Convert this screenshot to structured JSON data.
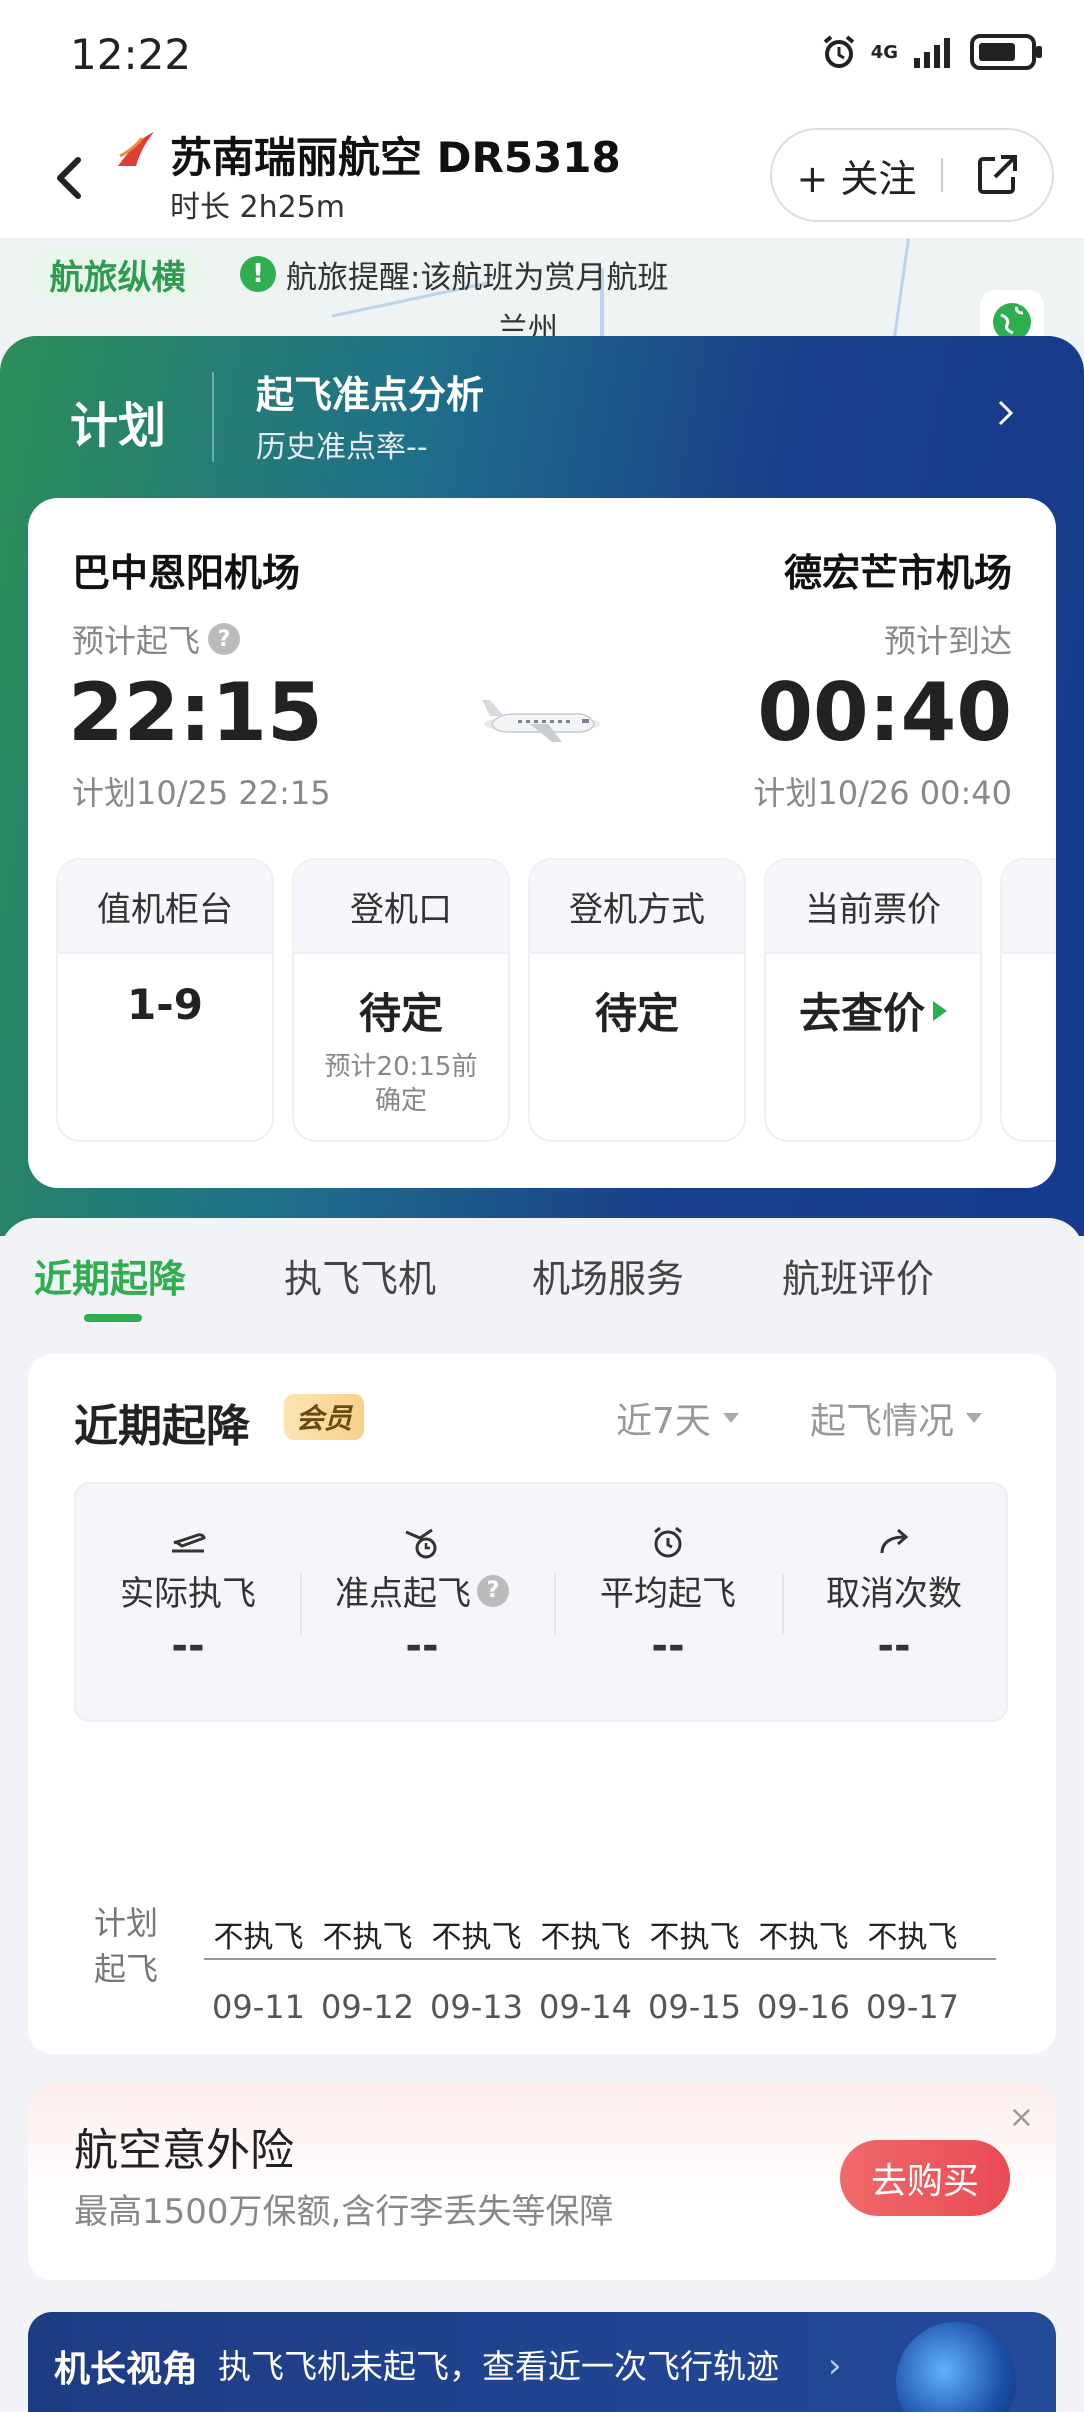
{
  "status_bar": {
    "time": "12:22",
    "network": "4G"
  },
  "header": {
    "title": "苏南瑞丽航空 DR5318",
    "duration": "时长 2h25m",
    "follow_label": "+ 关注"
  },
  "map_strip": {
    "brand": "航旅纵横",
    "alert_icon": "!",
    "alert_text": "航旅提醒:该航班为赏月航班",
    "city": "兰州"
  },
  "hero": {
    "plan_label": "计划",
    "ontime_title": "起飞准点分析",
    "ontime_sub": "历史准点率--"
  },
  "flight": {
    "dep_airport": "巴中恩阳机场",
    "arr_airport": "德宏芒市机场",
    "dep_label": "预计起飞",
    "arr_label": "预计到达",
    "dep_time": "22:15",
    "arr_time": "00:40",
    "dep_plan": "计划10/25 22:15",
    "arr_plan": "计划10/26 00:40",
    "help_icon": "?"
  },
  "info_cards": [
    {
      "head": "值机柜台",
      "value": "1-9",
      "note": ""
    },
    {
      "head": "登机口",
      "value": "待定",
      "note": "预计20:15前确定"
    },
    {
      "head": "登机方式",
      "value": "待定",
      "note": ""
    },
    {
      "head": "当前票价",
      "value": "去查价",
      "note": ""
    }
  ],
  "tabs": [
    "近期起降",
    "执飞飞机",
    "机场服务",
    "航班评价"
  ],
  "recent": {
    "title": "近期起降",
    "member_badge": "会员",
    "filter_range": "近7天",
    "filter_type": "起飞情况",
    "stats": [
      {
        "label": "实际执飞",
        "value": "--",
        "icon": "plane-takeoff-icon"
      },
      {
        "label": "准点起飞",
        "value": "--",
        "icon": "ontime-icon"
      },
      {
        "label": "平均起飞",
        "value": "--",
        "icon": "alarm-clock-icon"
      },
      {
        "label": "取消次数",
        "value": "--",
        "icon": "redo-arrow-icon"
      }
    ],
    "schedule_label": "计划起飞",
    "schedule_values": [
      "不执飞",
      "不执飞",
      "不执飞",
      "不执飞",
      "不执飞",
      "不执飞",
      "不执飞"
    ],
    "schedule_dates": [
      "09-11",
      "09-12",
      "09-13",
      "09-14",
      "09-15",
      "09-16",
      "09-17"
    ]
  },
  "insurance": {
    "title": "航空意外险",
    "subtitle": "最高1500万保额,含行李丢失等保障",
    "button": "去购买",
    "close": "×"
  },
  "captain": {
    "title": "机长视角",
    "text": "执飞飞机未起飞，查看近一次飞行轨迹",
    "arrow": "›"
  },
  "colors": {
    "accent_green": "#2eae4f",
    "hero_blue": "#1a3f8a",
    "insurance_red": "#e84b54"
  }
}
